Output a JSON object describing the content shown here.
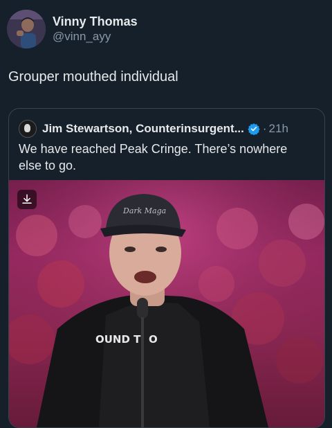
{
  "author": {
    "display_name": "Vinny Thomas",
    "handle": "@vinn_ayy",
    "avatar_icon": "user-avatar"
  },
  "tweet": {
    "text": "Grouper mouthed individual"
  },
  "quoted_tweet": {
    "author_name": "Jim Stewartson, Counterinsurgent...",
    "verified_icon": "verified-badge-icon",
    "separator": "·",
    "time": "21h",
    "text": "We have reached Peak Cringe. There’s nowhere else to go.",
    "media": {
      "download_icon": "download-icon",
      "shirt_text": "OUND T",
      "shirt_text_end": "O"
    }
  },
  "colors": {
    "background": "#15202b",
    "border": "#38444d",
    "secondary_text": "#8b98a5",
    "verified": "#1d9bf0"
  }
}
